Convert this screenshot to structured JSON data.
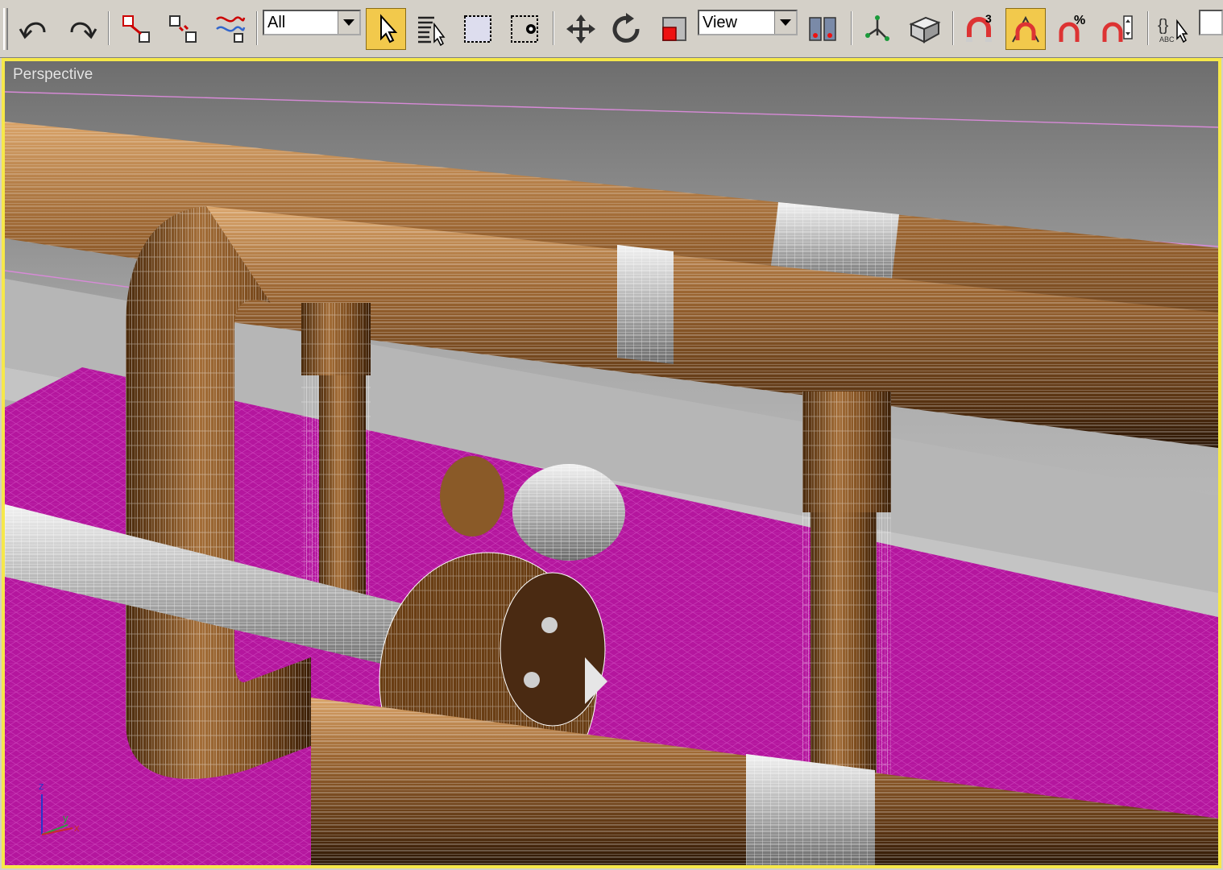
{
  "toolbar": {
    "selection_filter": "All",
    "reference_coord": "View",
    "snap_spinner_label": "3",
    "percent_snap_label": "%",
    "buttons": [
      {
        "name": "undo-icon"
      },
      {
        "name": "redo-icon"
      },
      {
        "name": "select-and-link-icon"
      },
      {
        "name": "unlink-selection-icon"
      },
      {
        "name": "bind-to-space-warp-icon"
      },
      {
        "name": "select-object-icon"
      },
      {
        "name": "select-by-name-icon"
      },
      {
        "name": "rectangular-selection-icon"
      },
      {
        "name": "window-crossing-icon"
      },
      {
        "name": "select-and-move-icon"
      },
      {
        "name": "select-and-rotate-icon"
      },
      {
        "name": "select-and-scale-icon"
      },
      {
        "name": "use-pivot-center-icon"
      },
      {
        "name": "select-and-manipulate-icon"
      },
      {
        "name": "keyboard-shortcut-override-icon"
      },
      {
        "name": "snaps-toggle-icon"
      },
      {
        "name": "angle-snap-toggle-icon"
      },
      {
        "name": "percent-snap-toggle-icon"
      },
      {
        "name": "spinner-snap-toggle-icon"
      },
      {
        "name": "edit-named-selection-icon"
      }
    ],
    "active_buttons": [
      "select-object",
      "angle-snap-toggle"
    ]
  },
  "viewport": {
    "label": "Perspective",
    "border_color": "#f6e84a",
    "axis_labels": {
      "z": "z",
      "y": "y",
      "x": "x"
    }
  },
  "colors": {
    "ground": "#b4169e",
    "pipe": "#7a4a1c",
    "pipe_light": "#a0683a",
    "steel": "#b8b8b8",
    "backdrop": "#9a9a9a",
    "wire": "#ffffff"
  }
}
